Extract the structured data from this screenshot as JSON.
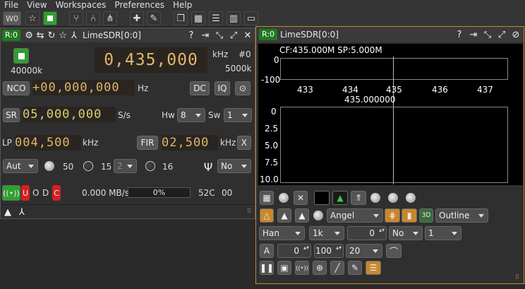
{
  "menu": [
    "File",
    "View",
    "Workspaces",
    "Preferences",
    "Help"
  ],
  "toolbar": {
    "workspace": "W0"
  },
  "left_panel": {
    "rx_badge": "R:0",
    "title": "LimeSDR[0:0]",
    "sample_rate_label": "40000k",
    "freq_digits": "0,435,000",
    "freq_unit": "kHz",
    "freq_index": "#0",
    "freq_step": "5000k",
    "nco_label": "NCO",
    "nco_value": "+00,000,000",
    "nco_unit": "Hz",
    "dc_label": "DC",
    "iq_label": "IQ",
    "sr_label": "SR",
    "sr_value": "05,000,000",
    "sr_unit": "S/s",
    "hw_label": "Hw",
    "hw_value": "8",
    "sw_label": "Sw",
    "sw_value": "1",
    "lp_label": "LP",
    "lp_value": "004,500",
    "lp_unit": "kHz",
    "fir_label": "FIR",
    "fir_value": "02,500",
    "fir_unit": "kHz",
    "fir_close": "X",
    "gain_mode": "Aut",
    "gain_value": "50",
    "lna_value": "15",
    "lna_combo": "2",
    "tia_value": "16",
    "antenna_value": "No",
    "flags": [
      "U",
      "O",
      "D",
      "C"
    ],
    "throughput": "0.000 MB/s",
    "progress_percent": 0,
    "progress_text": "0%",
    "temperature": "52C",
    "gpio": "00"
  },
  "right_panel": {
    "rx_badge": "R:0",
    "title": "LimeSDR[0:0]",
    "spectrum_info": "CF:435.000M SP:5.000M",
    "y_ticks": [
      "0",
      "-100"
    ],
    "x_ticks": [
      "433",
      "434",
      "435",
      "436",
      "437"
    ],
    "center_label": "435.000000",
    "wf_ticks": [
      "0",
      "2.5",
      "5.0",
      "7.5",
      "10.0"
    ],
    "palette": "Angel",
    "style": "Outline",
    "window": "Han",
    "fft_size": "1k",
    "overlap": "0",
    "averaging": "No",
    "avg_count": "1",
    "a_label": "A",
    "ref_level": "0",
    "range": "100",
    "fps": "20"
  }
}
